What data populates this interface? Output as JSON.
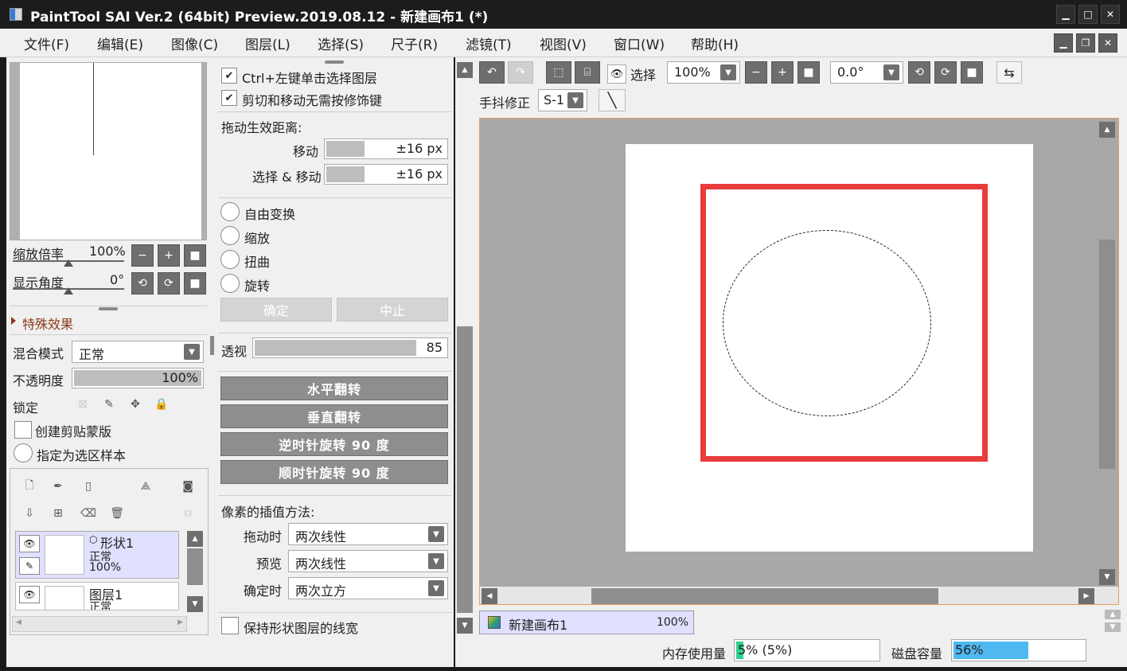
{
  "window": {
    "title": "PaintTool SAI Ver.2 (64bit) Preview.2019.08.12 - 新建画布1 (*)"
  },
  "menu": [
    "文件(F)",
    "编辑(E)",
    "图像(C)",
    "图层(L)",
    "选择(S)",
    "尺子(R)",
    "滤镜(T)",
    "视图(V)",
    "窗口(W)",
    "帮助(H)"
  ],
  "navigator": {
    "zoom_label": "缩放倍率",
    "zoom_value": "100%",
    "angle_label": "显示角度",
    "angle_value": "0°",
    "special_effects": "特殊效果"
  },
  "layer_props": {
    "blend_label": "混合模式",
    "blend_value": "正常",
    "opacity_label": "不透明度",
    "opacity_value": "100%",
    "lock_label": "锁定",
    "clip_label": "创建剪贴蒙版",
    "sample_label": "指定为选区样本"
  },
  "layers": [
    {
      "name": "形状1",
      "mode": "正常",
      "opacity": "100%"
    },
    {
      "name": "图层1",
      "mode": "正常"
    }
  ],
  "transform": {
    "opt_ctrl_click": "Ctrl+左键单击选择图层",
    "opt_no_modifier": "剪切和移动无需按修饰键",
    "drag_distance_label": "拖动生效距离:",
    "move_label": "移动",
    "move_value": "±16 px",
    "select_move_label": "选择 & 移动",
    "select_move_value": "±16 px",
    "free_transform": "自由变换",
    "scale": "缩放",
    "distort": "扭曲",
    "rotate": "旋转",
    "ok_label": "确定",
    "cancel_label": "中止",
    "perspective_label": "透视",
    "perspective_value": "85",
    "flip_h": "水平翻转",
    "flip_v": "垂直翻转",
    "rotate_ccw": "逆时针旋转 90 度",
    "rotate_cw": "顺时针旋转 90 度",
    "interp_label": "像素的插值方法:",
    "drag_label": "拖动时",
    "drag_value": "两次线性",
    "preview_label": "预览",
    "preview_value": "两次线性",
    "confirm_label": "确定时",
    "confirm_value": "两次立方",
    "keep_stroke": "保持形状图层的线宽"
  },
  "toolbar": {
    "selection_label": "选择",
    "zoom_value": "100%",
    "angle_value": "0.0°",
    "stabilizer_label": "手抖修正",
    "stabilizer_value": "S-1"
  },
  "statusbar": {
    "canvas_name": "新建画布1",
    "canvas_zoom": "100%",
    "memory_label": "内存使用量",
    "memory_value": "5% (5%)",
    "memory_fraction": 0.05,
    "disk_label": "磁盘容量",
    "disk_value": "56%",
    "disk_fraction": 0.56
  },
  "colors": {
    "accent_red": "#e83c3c",
    "layer_selected": "#e0e0ff"
  }
}
